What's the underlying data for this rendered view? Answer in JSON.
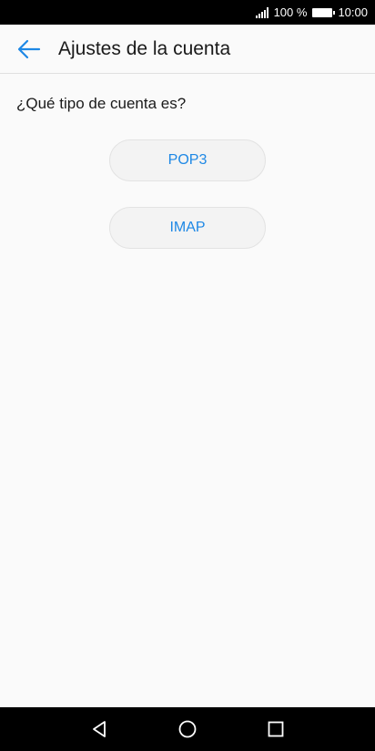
{
  "status_bar": {
    "battery_text": "100 %",
    "time": "10:00"
  },
  "app_bar": {
    "title": "Ajustes de la cuenta",
    "back_icon": "arrow-back-icon"
  },
  "main": {
    "question": "¿Qué tipo de cuenta es?",
    "options": [
      {
        "label": "POP3"
      },
      {
        "label": "IMAP"
      }
    ]
  },
  "nav_bar": {
    "icons": [
      "back-triangle-icon",
      "home-circle-icon",
      "recents-square-icon"
    ]
  },
  "colors": {
    "accent": "#1e88e5",
    "background": "#fafafa",
    "status_bar": "#000000"
  }
}
